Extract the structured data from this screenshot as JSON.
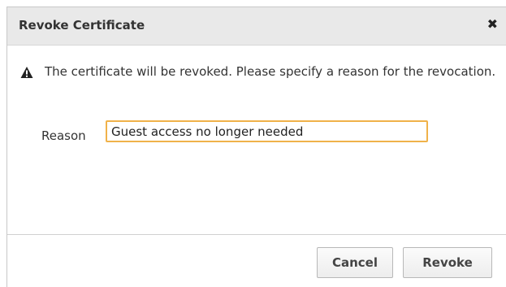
{
  "dialog": {
    "title": "Revoke Certificate",
    "close_glyph": "✖",
    "warning": {
      "icon": "warning-triangle-icon",
      "text": "The certificate will be revoked. Please specify a reason for the revocation."
    },
    "reason": {
      "label": "Reason",
      "value": "Guest access no longer needed"
    },
    "buttons": {
      "cancel_label": "Cancel",
      "revoke_label": "Revoke"
    },
    "colors": {
      "input_focus_border": "#f0b24a",
      "titlebar_bg": "#e9e9e9"
    }
  }
}
